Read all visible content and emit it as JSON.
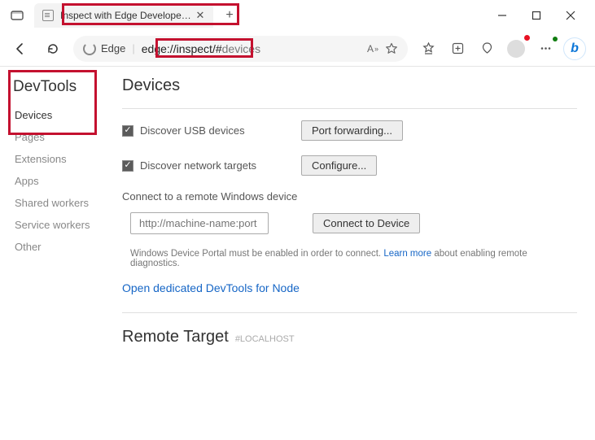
{
  "tab": {
    "title": "Inspect with Edge Developer To"
  },
  "address": {
    "hostLabel": "Edge",
    "url_prefix": "edge://inspect/#",
    "url_suffix": "devices",
    "readingLabel": "A"
  },
  "sidebar": {
    "title": "DevTools",
    "items": [
      {
        "label": "Devices",
        "active": true
      },
      {
        "label": "Pages"
      },
      {
        "label": "Extensions"
      },
      {
        "label": "Apps"
      },
      {
        "label": "Shared workers"
      },
      {
        "label": "Service workers"
      },
      {
        "label": "Other"
      }
    ]
  },
  "main": {
    "heading": "Devices",
    "usb": {
      "label": "Discover USB devices",
      "button": "Port forwarding..."
    },
    "net": {
      "label": "Discover network targets",
      "button": "Configure..."
    },
    "remoteWin": {
      "heading": "Connect to a remote Windows device",
      "placeholder": "http://machine-name:port",
      "button": "Connect to Device",
      "note_pre": "Windows Device Portal must be enabled in order to connect. ",
      "note_link": "Learn more",
      "note_post": " about enabling remote diagnostics."
    },
    "nodeLink": "Open dedicated DevTools for Node",
    "remoteTarget": {
      "heading": "Remote Target",
      "hash": "#LOCALHOST"
    }
  }
}
